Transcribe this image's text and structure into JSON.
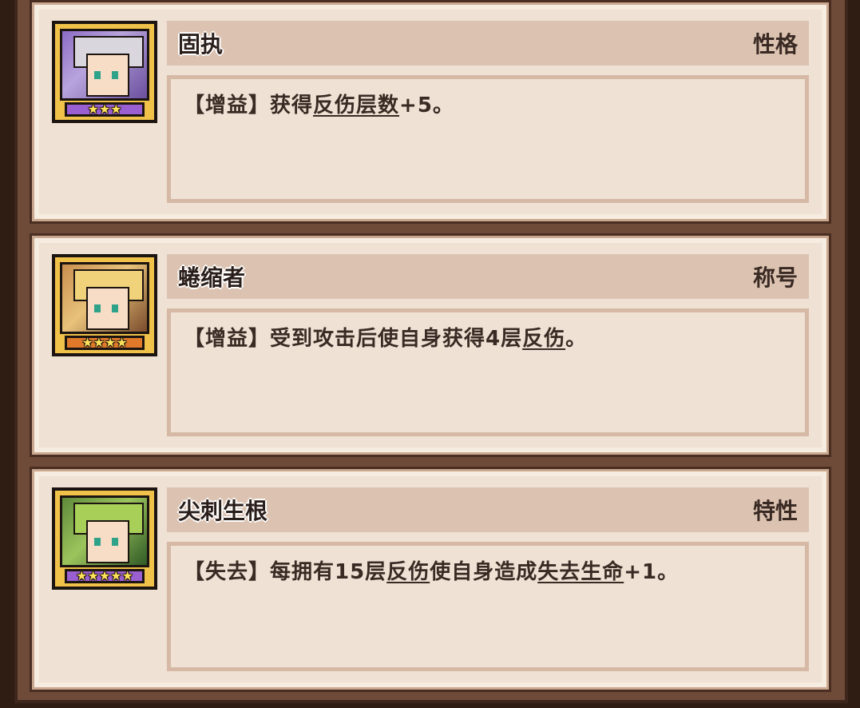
{
  "cards": [
    {
      "name": "固执",
      "category": "性格",
      "desc_prefix": "【增益】获得",
      "desc_kw1": "反伤层数",
      "desc_suffix": "+5。",
      "stars": "★★★"
    },
    {
      "name": "蜷缩者",
      "category": "称号",
      "desc_prefix": "【增益】受到攻击后使自身获得4层",
      "desc_kw1": "反伤",
      "desc_suffix": "。",
      "stars": "★★★★"
    },
    {
      "name": "尖刺生根",
      "category": "特性",
      "desc_prefix": "【失去】每拥有15层",
      "desc_kw1": "反伤",
      "desc_mid": "使自身造成",
      "desc_kw2": "失去生命",
      "desc_suffix": "+1。",
      "stars": "★★★★★"
    }
  ],
  "colors": {
    "card_bg": "#efe1d3",
    "title_bar": "#dcc3b1",
    "frame": "#6e4a38",
    "text": "#3a2a24"
  }
}
